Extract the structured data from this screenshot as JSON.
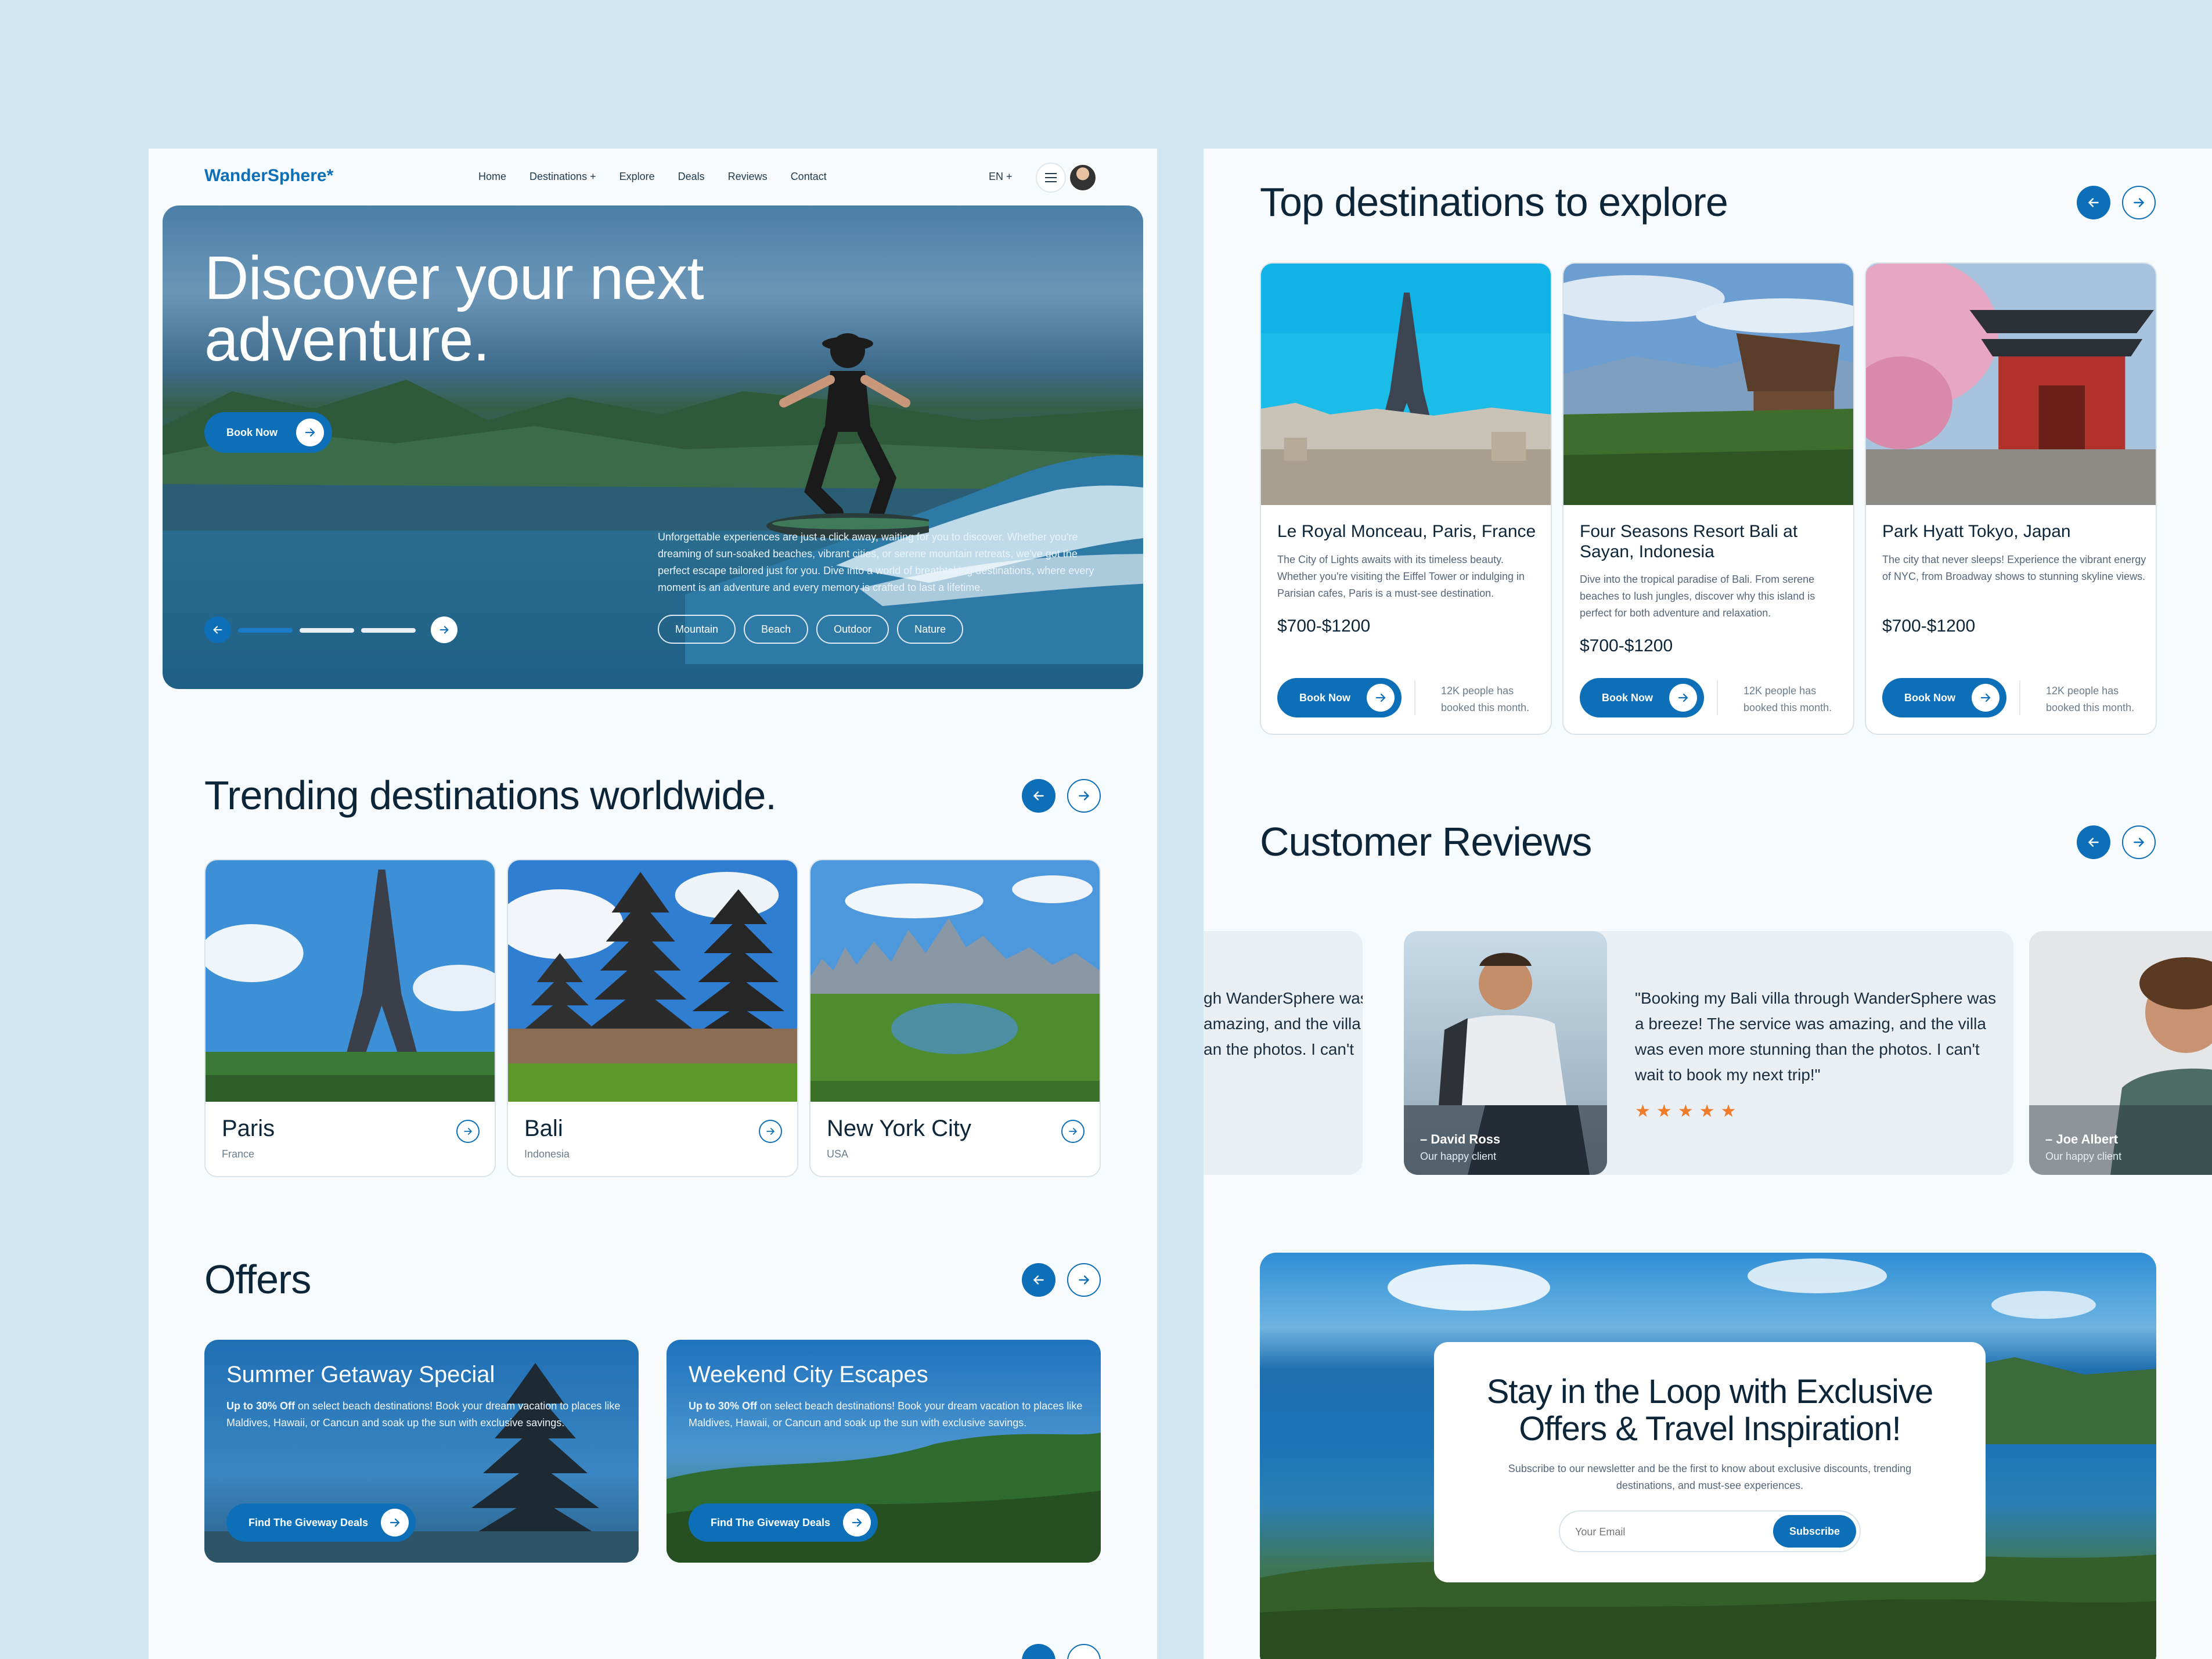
{
  "nav": {
    "logo": "WanderSphere*",
    "links": [
      "Home",
      "Destinations +",
      "Explore",
      "Deals",
      "Reviews",
      "Contact"
    ],
    "lang": "EN +"
  },
  "hero": {
    "title": "Discover your next adventure.",
    "book_label": "Book Now",
    "description": "Unforgettable experiences are just a click away, waiting for you to discover. Whether you're dreaming of sun-soaked beaches, vibrant cities, or serene mountain retreats, we've got the perfect escape tailored just for you. Dive into a world of breathtaking destinations, where every moment is an adventure and every memory is crafted to last a lifetime.",
    "tags": [
      "Mountain",
      "Beach",
      "Outdoor",
      "Nature"
    ],
    "slide_count": 3,
    "active_slide": 1
  },
  "trending": {
    "title": "Trending destinations worldwide.",
    "items": [
      {
        "name": "Paris",
        "country": "France"
      },
      {
        "name": "Bali",
        "country": "Indonesia"
      },
      {
        "name": "New York City",
        "country": "USA"
      }
    ]
  },
  "offers": {
    "title": "Offers",
    "items": [
      {
        "title": "Summer Getaway Special",
        "highlight": "Up to 30% Off",
        "desc": " on select beach destinations! Book your dream vacation to places like Maldives, Hawaii, or Cancun and soak up the sun with exclusive savings.",
        "button": "Find The Giveway Deals"
      },
      {
        "title": "Weekend City Escapes",
        "highlight": "Up to 30% Off",
        "desc": " on select beach destinations! Book your dream vacation to places like Maldives, Hawaii, or Cancun and soak up the sun with exclusive savings.",
        "button": "Find The Giveway Deals"
      }
    ]
  },
  "top_destinations": {
    "title": "Top destinations to explore",
    "items": [
      {
        "name": "Le Royal Monceau, Paris, France",
        "desc": "The City of Lights awaits with its timeless beauty. Whether you're visiting the Eiffel Tower or indulging in Parisian cafes, Paris is a must-see destination.",
        "price": "$700-$1200",
        "button": "Book Now",
        "booked": "12K people has booked this month."
      },
      {
        "name": "Four Seasons Resort Bali at Sayan, Indonesia",
        "desc": "Dive into the tropical paradise of Bali. From serene beaches to lush jungles, discover why this island is perfect for both adventure and relaxation.",
        "price": "$700-$1200",
        "button": "Book Now",
        "booked": "12K people has booked this month."
      },
      {
        "name": "Park Hyatt Tokyo, Japan",
        "desc": "The city that never sleeps! Experience the vibrant energy of NYC, from Broadway shows to stunning skyline views.",
        "price": "$700-$1200",
        "button": "Book Now",
        "booked": "12K people has booked this month."
      }
    ]
  },
  "reviews": {
    "title": "Customer Reviews",
    "partial_quote": "gh WanderSphere was amazing, and the villa an the photos. I can't",
    "main": {
      "quote": "\"Booking my Bali villa through WanderSphere was a breeze! The service was amazing, and the villa was even more stunning than the photos. I can't wait to book my next trip!\"",
      "name": "– David Ross",
      "role": "Our happy client",
      "rating": 5
    },
    "next": {
      "name": "– Joe Albert",
      "role": "Our happy client"
    }
  },
  "newsletter": {
    "title": "Stay in the Loop with Exclusive Offers & Travel Inspiration!",
    "subtitle": "Subscribe to our newsletter and be the first to know about exclusive discounts, trending destinations, and must-see experiences.",
    "placeholder": "Your Email",
    "button": "Subscribe"
  },
  "colors": {
    "accent": "#0d6fb8",
    "star": "#f07c2a",
    "background": "#d3e6f3"
  }
}
